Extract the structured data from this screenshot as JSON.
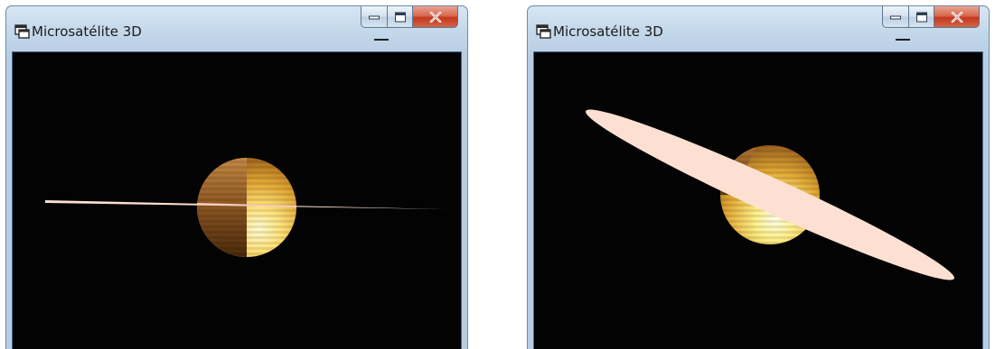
{
  "windows": [
    {
      "title": "Microsatélite 3D",
      "icon": "window-icon",
      "controls": [
        "minimize",
        "maximize",
        "close"
      ],
      "scene": {
        "planet": "sphere",
        "ring": "horizontal"
      }
    },
    {
      "title": "Microsatélite 3D",
      "icon": "window-icon",
      "controls": [
        "minimize",
        "maximize",
        "close"
      ],
      "scene": {
        "planet": "sphere",
        "ring": "tilted"
      }
    }
  ],
  "colors": {
    "titlebar": "#c7daec",
    "viewport_background": "#030303",
    "ring": "#fde0d2",
    "planet_light": "#fff3a0",
    "planet_dark": "#6b3a10",
    "close_button": "#c9432a"
  }
}
